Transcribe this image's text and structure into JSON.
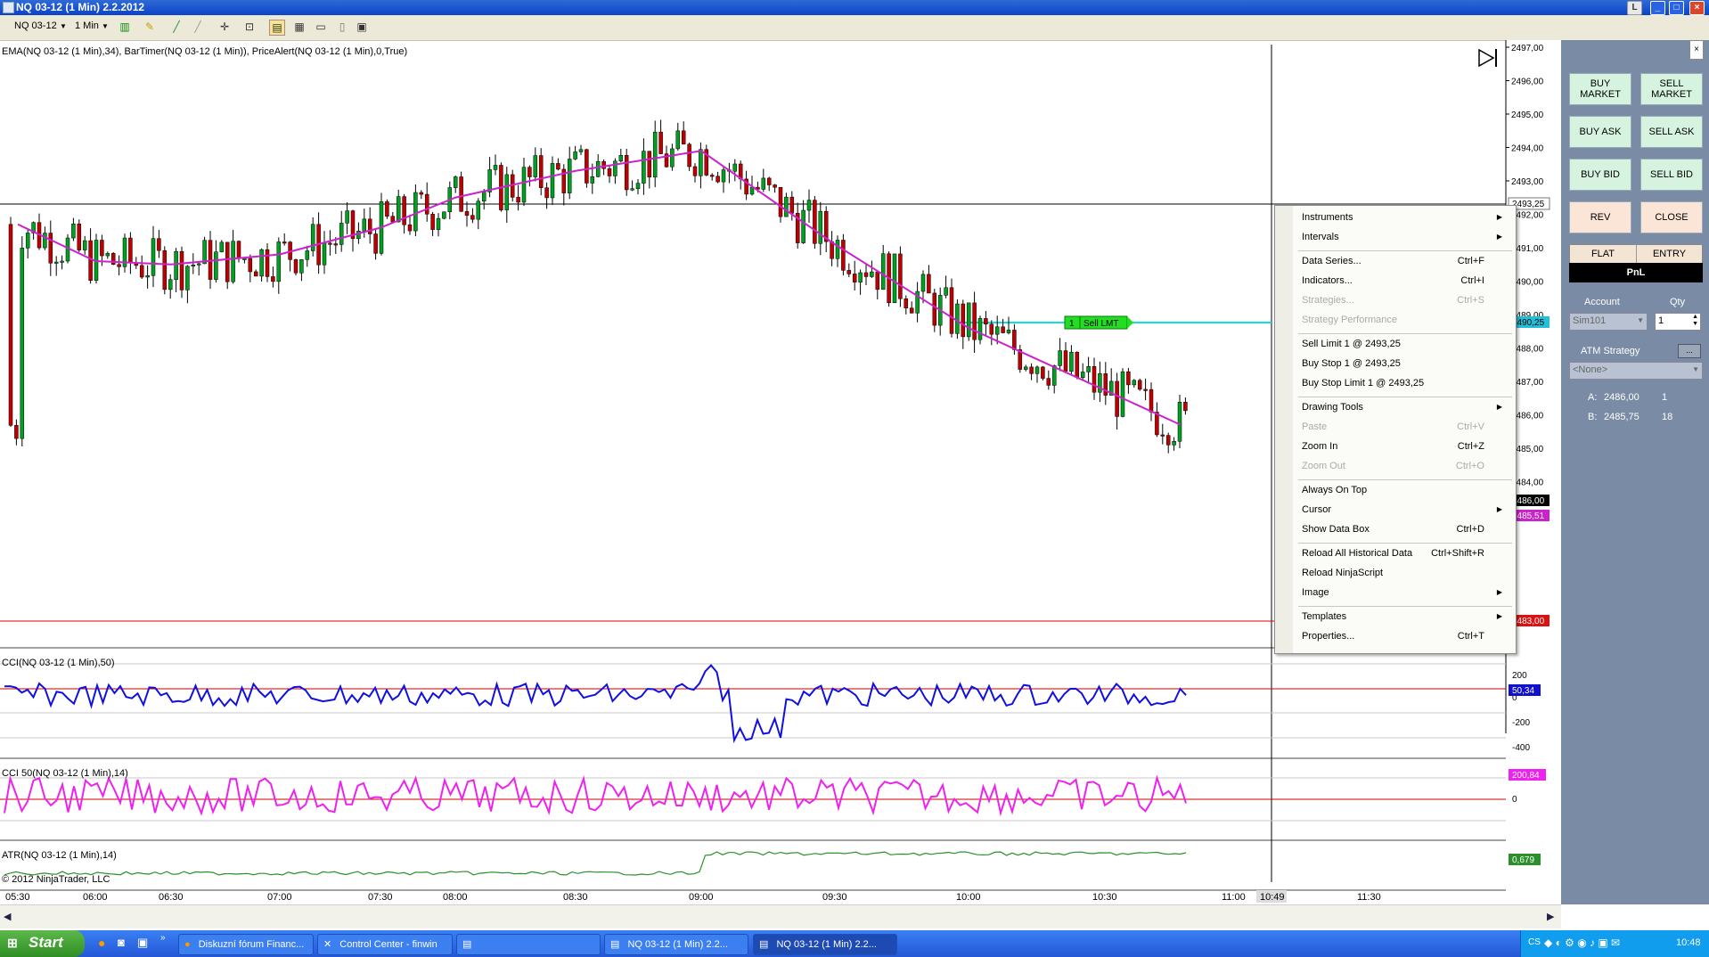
{
  "window": {
    "title": "NQ 03-12 (1 Min)  2.2.2012"
  },
  "toolbar": {
    "instrument": "NQ 03-12",
    "interval": "1 Min"
  },
  "chart": {
    "indicator_label": "EMA(NQ 03-12 (1 Min),34), BarTimer(NQ 03-12 (1 Min)), PriceAlert(NQ 03-12 (1 Min),0,True)",
    "price_ticks": [
      "2497,00",
      "2496,00",
      "2495,00",
      "2494,00",
      "2493,00",
      "2492,00",
      "2491,00",
      "2490,00",
      "2489,00",
      "2488,00",
      "2487,00",
      "2486,00",
      "2485,00",
      "2484,00"
    ],
    "markers": {
      "crosshair": "2493,25",
      "sell_lmt_price": "2490,25",
      "ask": "2486,00",
      "ema": "2485,51",
      "low": "2483,00"
    },
    "order": {
      "qty": "1",
      "label": "Sell LMT"
    },
    "time_ticks": [
      "05:30",
      "06:00",
      "06:30",
      "07:00",
      "07:30",
      "08:00",
      "08:30",
      "09:00",
      "09:30",
      "10:00",
      "10:30",
      "11:00",
      "11:30"
    ],
    "cursor_time": "10:49",
    "cci_label": "CCI(NQ 03-12 (1 Min),50)",
    "cci_ticks": [
      "200",
      "0",
      "-200",
      "-400"
    ],
    "cci_value": "50,34",
    "cci50_label": "CCI 50(NQ 03-12 (1 Min),14)",
    "cci50_tick": "0",
    "cci50_value": "200,84",
    "atr_label": "ATR(NQ 03-12 (1 Min),14)",
    "atr_value": "0,679",
    "copyright": "© 2012 NinjaTrader, LLC",
    "colors": {
      "up": "#00a020",
      "down": "#c00000",
      "ema": "#cc22cc",
      "cci": "#1010e0",
      "cci50": "#ee22ee",
      "atr": "#2b8f2b"
    }
  },
  "chart_data": {
    "type": "line",
    "title": "NQ 03-12 (1 Min)",
    "x_labels": [
      "05:30",
      "06:00",
      "06:30",
      "07:00",
      "07:30",
      "08:00",
      "08:30",
      "09:00",
      "09:30",
      "10:00",
      "10:30"
    ],
    "series": [
      {
        "name": "EMA(NQ 03-12 (1 Min),34)",
        "values": [
          2491.7,
          2490.6,
          2490.5,
          2490.8,
          2491.6,
          2492.5,
          2493.3,
          2493.9,
          2491.1,
          2488.6,
          2485.7
        ]
      }
    ],
    "ylim": [
      2483,
      2497
    ]
  },
  "context_menu": {
    "items": [
      {
        "label": "Instruments",
        "shortcut": "",
        "arrow": true,
        "disabled": false
      },
      {
        "label": "Intervals",
        "shortcut": "",
        "arrow": true,
        "disabled": false
      },
      {
        "sep": true
      },
      {
        "label": "Data Series...",
        "shortcut": "Ctrl+F",
        "arrow": false,
        "disabled": false
      },
      {
        "label": "Indicators...",
        "shortcut": "Ctrl+I",
        "arrow": false,
        "disabled": false
      },
      {
        "label": "Strategies...",
        "shortcut": "Ctrl+S",
        "arrow": false,
        "disabled": true
      },
      {
        "label": "Strategy Performance",
        "shortcut": "",
        "arrow": false,
        "disabled": true
      },
      {
        "sep": true
      },
      {
        "label": "Sell Limit 1 @ 2493,25",
        "shortcut": "",
        "arrow": false,
        "disabled": false
      },
      {
        "label": "Buy Stop 1 @ 2493,25",
        "shortcut": "",
        "arrow": false,
        "disabled": false
      },
      {
        "label": "Buy Stop Limit 1 @ 2493,25",
        "shortcut": "",
        "arrow": false,
        "disabled": false
      },
      {
        "sep": true
      },
      {
        "label": "Drawing Tools",
        "shortcut": "",
        "arrow": true,
        "disabled": false
      },
      {
        "label": "Paste",
        "shortcut": "Ctrl+V",
        "arrow": false,
        "disabled": true
      },
      {
        "label": "Zoom In",
        "shortcut": "Ctrl+Z",
        "arrow": false,
        "disabled": false
      },
      {
        "label": "Zoom Out",
        "shortcut": "Ctrl+O",
        "arrow": false,
        "disabled": true
      },
      {
        "sep": true
      },
      {
        "label": "Always On Top",
        "shortcut": "",
        "arrow": false,
        "disabled": false
      },
      {
        "label": "Cursor",
        "shortcut": "",
        "arrow": true,
        "disabled": false
      },
      {
        "label": "Show Data Box",
        "shortcut": "Ctrl+D",
        "arrow": false,
        "disabled": false
      },
      {
        "sep": true
      },
      {
        "label": "Reload All Historical Data",
        "shortcut": "Ctrl+Shift+R",
        "arrow": false,
        "disabled": false
      },
      {
        "label": "Reload NinjaScript",
        "shortcut": "",
        "arrow": false,
        "disabled": false
      },
      {
        "label": "Image",
        "shortcut": "",
        "arrow": true,
        "disabled": false
      },
      {
        "sep": true
      },
      {
        "label": "Templates",
        "shortcut": "",
        "arrow": true,
        "disabled": false
      },
      {
        "label": "Properties...",
        "shortcut": "Ctrl+T",
        "arrow": false,
        "disabled": false
      }
    ]
  },
  "panel": {
    "buy_market": "BUY MARKET",
    "sell_market": "SELL MARKET",
    "buy_ask": "BUY ASK",
    "sell_ask": "SELL ASK",
    "buy_bid": "BUY BID",
    "sell_bid": "SELL BID",
    "rev": "REV",
    "close": "CLOSE",
    "flat": "FLAT",
    "entry": "ENTRY",
    "pnl": "PnL",
    "account_label": "Account",
    "qty_label": "Qty",
    "account_value": "Sim101",
    "qty_value": "1",
    "atm_label": "ATM Strategy",
    "atm_btn": "...",
    "atm_value": "<None>",
    "ask_label": "A:",
    "ask_price": "2486,00",
    "ask_size": "1",
    "bid_label": "B:",
    "bid_price": "2485,75",
    "bid_size": "18"
  },
  "taskbar": {
    "start": "Start",
    "tasks": [
      "Diskuzní fórum Financ...",
      "Control Center - finwin",
      "",
      "NQ 03-12 (1 Min)  2.2..."
    ],
    "lang": "CS",
    "clock": "10:48"
  }
}
